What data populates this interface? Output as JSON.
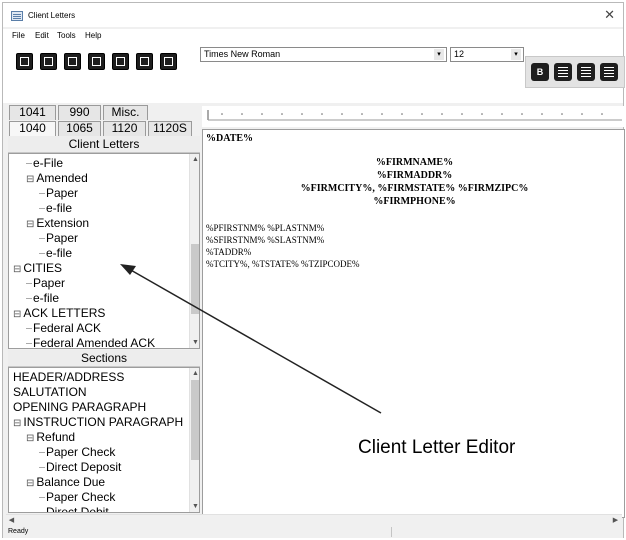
{
  "window": {
    "title": "Client Letters",
    "close_glyph": "✕",
    "app_icon": "document-icon"
  },
  "menu": [
    "File",
    "Edit",
    "Tools",
    "Help"
  ],
  "toolbar": {
    "buttons": [
      "open-icon",
      "save-icon",
      "preview-icon",
      "print-icon",
      "export-icon",
      "form-icon",
      "insert-icon"
    ],
    "font_family": "Times New Roman",
    "font_size": "12",
    "dropdown_glyph": "▾",
    "bold_label": "B",
    "align_buttons": [
      "align-left-icon",
      "align-center-icon",
      "align-right-icon"
    ]
  },
  "tabs": {
    "row1": [
      "1041",
      "990",
      "Misc."
    ],
    "row2": [
      "1040",
      "1065",
      "1120",
      "1120S"
    ],
    "active": "1040"
  },
  "client_letters": {
    "header": "Client Letters",
    "items": [
      {
        "text": "e-File",
        "indent": 1,
        "prefix": ""
      },
      {
        "text": "Amended",
        "indent": 1,
        "prefix": "⊟"
      },
      {
        "text": "Paper",
        "indent": 2,
        "prefix": ""
      },
      {
        "text": "e-file",
        "indent": 2,
        "prefix": ""
      },
      {
        "text": "Extension",
        "indent": 1,
        "prefix": "⊟"
      },
      {
        "text": "Paper",
        "indent": 2,
        "prefix": ""
      },
      {
        "text": "e-file",
        "indent": 2,
        "prefix": ""
      },
      {
        "text": "CITIES",
        "indent": 0,
        "prefix": "⊟"
      },
      {
        "text": "Paper",
        "indent": 1,
        "prefix": ""
      },
      {
        "text": "e-file",
        "indent": 1,
        "prefix": ""
      },
      {
        "text": "ACK LETTERS",
        "indent": 0,
        "prefix": "⊟"
      },
      {
        "text": "Federal ACK",
        "indent": 1,
        "prefix": ""
      },
      {
        "text": "Federal Amended ACK",
        "indent": 1,
        "prefix": ""
      }
    ]
  },
  "sections": {
    "header": "Sections",
    "items": [
      {
        "text": "HEADER/ADDRESS",
        "indent": 0,
        "prefix": ""
      },
      {
        "text": "SALUTATION",
        "indent": 0,
        "prefix": ""
      },
      {
        "text": "OPENING PARAGRAPH",
        "indent": 0,
        "prefix": ""
      },
      {
        "text": "INSTRUCTION PARAGRAPH",
        "indent": 0,
        "prefix": "⊟"
      },
      {
        "text": "Refund",
        "indent": 1,
        "prefix": "⊟"
      },
      {
        "text": "Paper Check",
        "indent": 2,
        "prefix": ""
      },
      {
        "text": "Direct Deposit",
        "indent": 2,
        "prefix": ""
      },
      {
        "text": "Balance Due",
        "indent": 1,
        "prefix": "⊟"
      },
      {
        "text": "Paper Check",
        "indent": 2,
        "prefix": ""
      },
      {
        "text": "Direct Debit",
        "indent": 2,
        "prefix": ""
      }
    ]
  },
  "editor": {
    "date": "%DATE%",
    "firm_lines": [
      "%FIRMNAME%",
      "%FIRMADDR%",
      "%FIRMCITY%, %FIRMSTATE% %FIRMZIPC%",
      "%FIRMPHONE%"
    ],
    "client_lines": [
      "%PFIRSTNM% %PLASTNM%",
      "%SFIRSTNM% %SLASTNM%",
      "%TADDR%",
      "%TCITY%, %TSTATE% %TZIPCODE%"
    ]
  },
  "callout": "Client Letter Editor",
  "status": "Ready",
  "scroll_glyphs": {
    "up": "▲",
    "down": "▼",
    "left": "◀",
    "right": "▶"
  }
}
